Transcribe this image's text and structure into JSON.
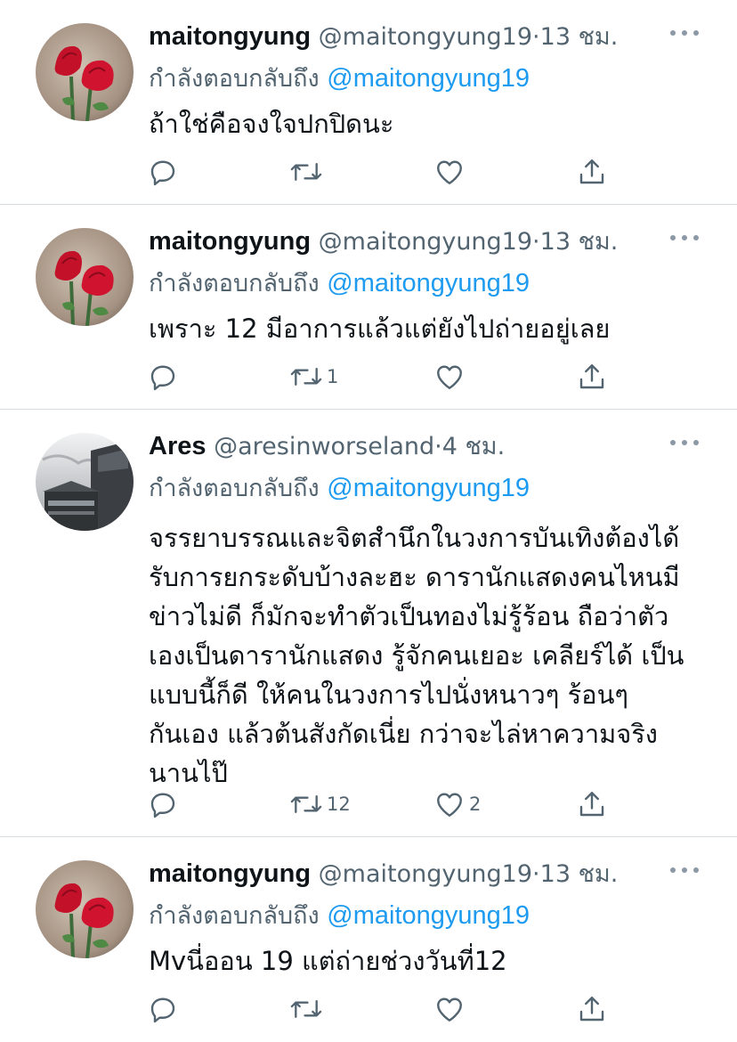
{
  "colors": {
    "text": "#0f1419",
    "secondary": "#536471",
    "link": "#1d9bf0",
    "divider": "#d8dde1"
  },
  "icons": {
    "more": "more-dots-icon",
    "reply": "reply-icon",
    "retweet": "retweet-icon",
    "like": "heart-icon",
    "share": "share-icon"
  },
  "tweets": [
    {
      "name": "maitongyung",
      "handle": "@maitongyung19",
      "dot": "·",
      "time": "13 ชม.",
      "replying_label": "กำลังตอบกลับถึง",
      "replying_to": "@maitongyung19",
      "text": "ถ้าใช่คือจงใจปกปิดนะ",
      "retweets": "",
      "likes": ""
    },
    {
      "name": "maitongyung",
      "handle": "@maitongyung19",
      "dot": "·",
      "time": "13 ชม.",
      "replying_label": "กำลังตอบกลับถึง",
      "replying_to": "@maitongyung19",
      "text": "เพราะ 12 มีอาการแล้วแต่ยังไปถ่ายอยู่เลย",
      "retweets": "1",
      "likes": ""
    },
    {
      "name": "Ares",
      "handle": "@aresinworseland",
      "dot": "·",
      "time": "4 ชม.",
      "replying_label": "กำลังตอบกลับถึง",
      "replying_to": "@maitongyung19",
      "text": "จรรยาบรรณและจิตสำนึกในวงการบันเทิงต้องได้รับการยกระดับบ้างละฮะ ดารานักแสดงคนไหนมีข่าวไม่ดี ก็มักจะทำตัวเป็นทองไม่รู้ร้อน ถือว่าตัวเองเป็นดารานักแสดง รู้จักคนเยอะ เคลียร์ได้ เป็นแบบนี้ก็ดี ให้คนในวงการไปนั่งหนาวๆ ร้อนๆ กันเอง แล้วต้นสังกัดเนี่ย กว่าจะไล่หาความจริงนานไป๊",
      "retweets": "12",
      "likes": "2"
    },
    {
      "name": "maitongyung",
      "handle": "@maitongyung19",
      "dot": "·",
      "time": "13 ชม.",
      "replying_label": "กำลังตอบกลับถึง",
      "replying_to": "@maitongyung19",
      "text": "Mvนี่ออน 19 แต่ถ่ายช่วงวันที่12",
      "retweets": "",
      "likes": ""
    }
  ]
}
